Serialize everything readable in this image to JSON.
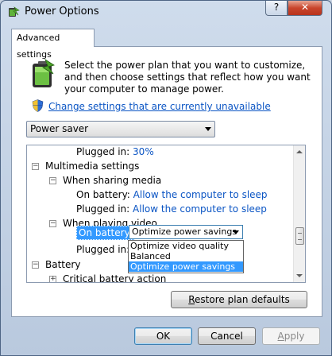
{
  "window": {
    "title": "Power Options",
    "help_label": "?",
    "close_label": "✕"
  },
  "tab": {
    "label": "Advanced settings"
  },
  "description": "Select the power plan that you want to customize, and then choose settings that reflect how you want your computer to manage power.",
  "change_link": "Change settings that are currently unavailable",
  "plan_select": {
    "selected": "Power saver"
  },
  "tree": {
    "rows": [
      {
        "label": "Plugged in:",
        "value": "30%"
      },
      {
        "label": "Multimedia settings"
      },
      {
        "label": "When sharing media"
      },
      {
        "label": "On battery:",
        "value": "Allow the computer to sleep"
      },
      {
        "label": "Plugged in:",
        "value": "Allow the computer to sleep"
      },
      {
        "label": "When playing video"
      },
      {
        "label": "On battery:",
        "value": "Optimize power savings"
      },
      {
        "label": "Plugged in:"
      },
      {
        "label": "Battery"
      },
      {
        "label": "Critical battery action"
      }
    ],
    "expander_minus": "−",
    "expander_plus": "+"
  },
  "dropdown": {
    "options": [
      "Optimize video quality",
      "Balanced",
      "Optimize power savings"
    ],
    "selected_index": 2
  },
  "buttons": {
    "restore": "Restore plan defaults",
    "restore_accel": "R",
    "ok": "OK",
    "cancel": "Cancel",
    "apply": "Apply",
    "apply_accel": "A"
  }
}
